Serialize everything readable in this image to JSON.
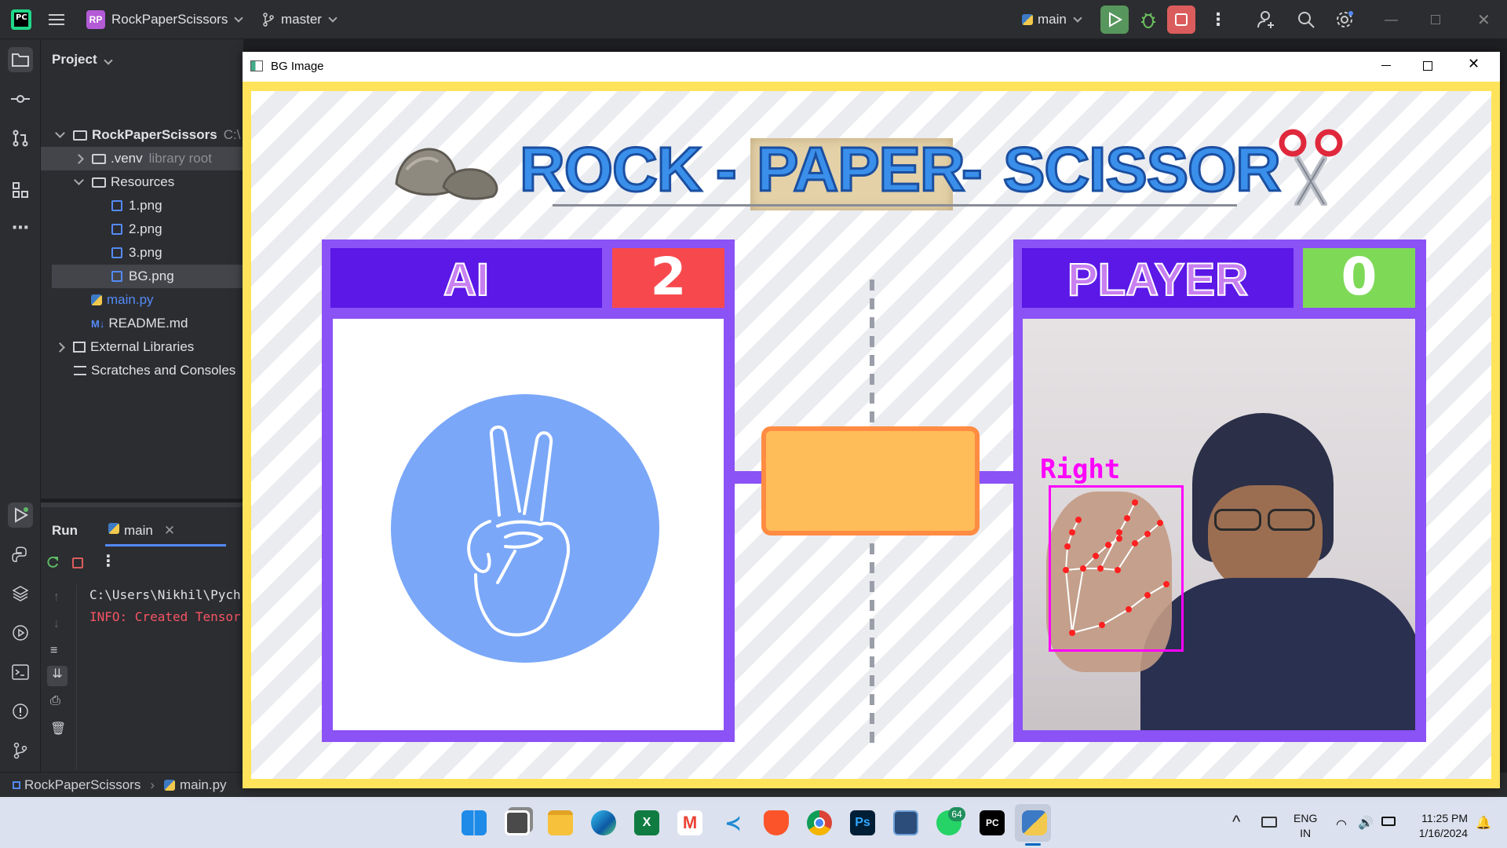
{
  "ide": {
    "project_badge": "RP",
    "project_name": "RockPaperScissors",
    "branch": "master",
    "run_config": "main"
  },
  "project_panel": {
    "title": "Project",
    "root": "RockPaperScissors",
    "root_hint": "C:\\",
    "items": [
      {
        "label": "RockPaperScissors",
        "hint": "C:\\"
      },
      {
        "label": ".venv",
        "hint": "library root"
      },
      {
        "label": "Resources"
      },
      {
        "label": "1.png"
      },
      {
        "label": "2.png"
      },
      {
        "label": "3.png"
      },
      {
        "label": "BG.png"
      },
      {
        "label": "main.py"
      },
      {
        "label": "README.md"
      },
      {
        "label": "External Libraries"
      },
      {
        "label": "Scratches and Consoles"
      }
    ]
  },
  "run_panel": {
    "tab_run": "Run",
    "tab_main": "main",
    "console_lines": [
      "C:\\Users\\Nikhil\\Pych",
      "INFO: Created Tensor"
    ]
  },
  "status_bar": {
    "breadcrumb_project": "RockPaperScissors",
    "breadcrumb_file": "main.py"
  },
  "bg_window": {
    "title": "BG Image",
    "game": {
      "title_rock": "ROCK",
      "title_dash1": "-",
      "title_paper": "PAPER",
      "title_dash2": "-",
      "title_scissor": "SCISSOR",
      "ai_label": "AI",
      "ai_score": "2",
      "player_label": "PLAYER",
      "player_score": "0",
      "hand_label": "Right",
      "ai_move": "scissors"
    }
  },
  "taskbar": {
    "lang_top": "ENG",
    "lang_bottom": "IN",
    "time": "11:25 PM",
    "date": "1/16/2024",
    "whatsapp_badge": "64"
  },
  "colors": {
    "ide_bg": "#2b2d30",
    "frame_yellow": "#ffe35a",
    "panel_purple": "#8b52f5",
    "header_purple": "#5b18e6",
    "ai_score_red": "#f7494d",
    "player_score_green": "#7ed957",
    "ai_circle_blue": "#7aa7f8",
    "result_box_orange": "#ffbd59",
    "hand_box_magenta": "#ff00ff"
  }
}
